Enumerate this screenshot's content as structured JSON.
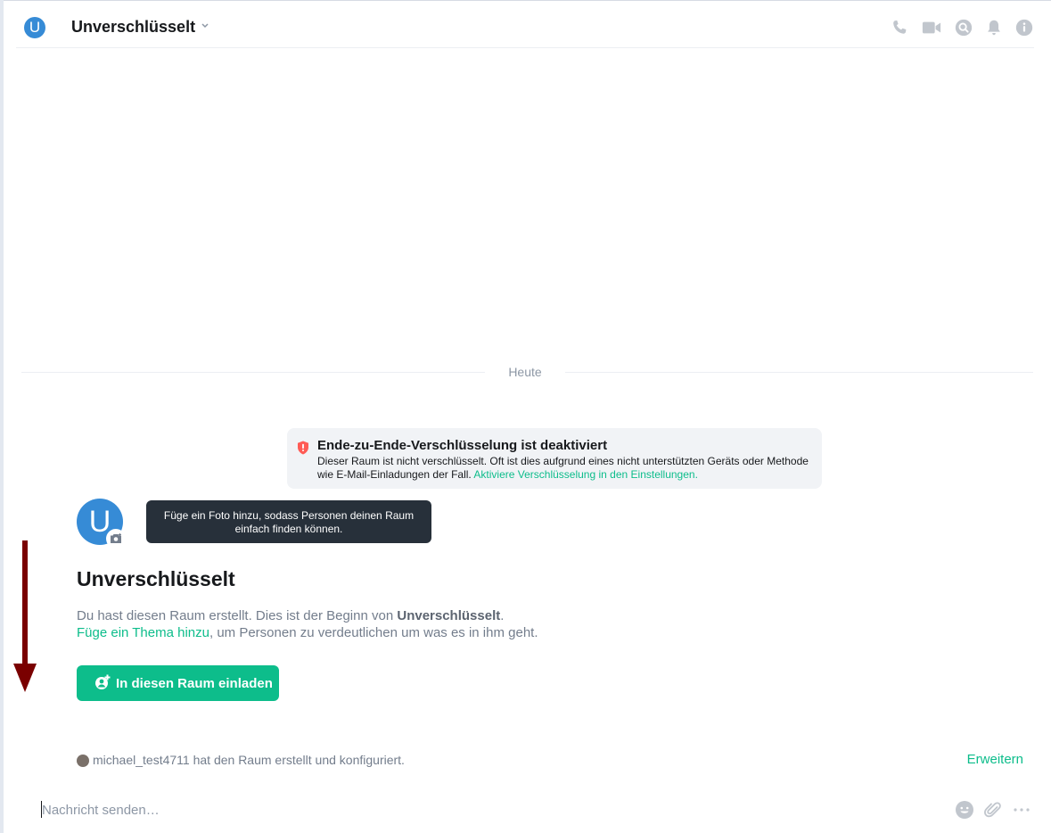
{
  "header": {
    "avatar_letter": "U",
    "room_name": "Unverschlüsselt",
    "icons": [
      "phone-icon",
      "video-icon",
      "search-icon",
      "bell-icon",
      "info-icon"
    ]
  },
  "timeline": {
    "date_separator": "Heute"
  },
  "encryption_notice": {
    "title": "Ende-zu-Ende-Verschlüsselung ist deaktiviert",
    "description": "Dieser Raum ist nicht verschlüsselt. Oft ist dies aufgrund eines nicht unterstützten Geräts oder Methode wie E-Mail-Einladungen der Fall.",
    "link": "Aktiviere Verschlüsselung in den Einstellungen."
  },
  "room_intro": {
    "avatar_letter": "U",
    "tooltip": "Füge ein Foto hinzu, sodass Personen deinen Raum einfach finden können.",
    "title": "Unverschlüsselt",
    "created_prefix": "Du hast diesen Raum erstellt. Dies ist der Beginn von",
    "room_name_bold": "Unverschlüsselt",
    "created_suffix": ".",
    "topic_link": "Füge ein Thema hinzu",
    "topic_suffix": ", um Personen zu verdeutlichen um was es in ihm geht.",
    "invite_button": "In diesen Raum einladen"
  },
  "event_summary": {
    "text": "michael_test4711 hat den Raum erstellt und konfiguriert.",
    "expand": "Erweitern"
  },
  "composer": {
    "placeholder": "Nachricht senden…"
  },
  "colors": {
    "accent": "#0dbd8b",
    "avatar": "#368bd6",
    "warning": "#ff5b55",
    "annotation_arrow": "#7a0000"
  }
}
